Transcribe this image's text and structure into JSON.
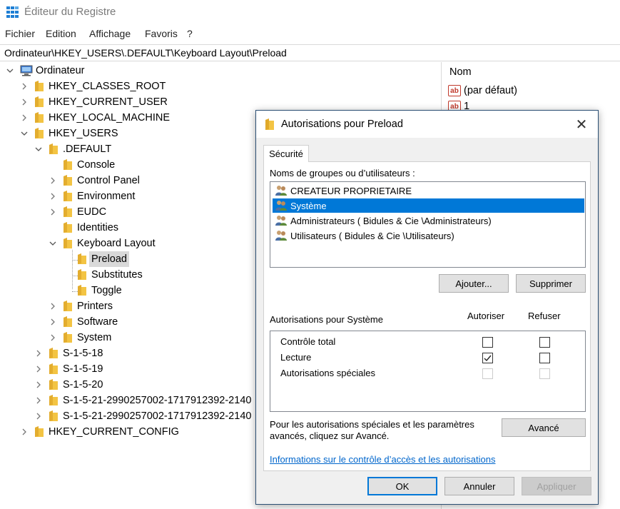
{
  "window": {
    "title": "Éditeur du Registre",
    "menu": [
      "Fichier",
      "Edition",
      "Affichage",
      "Favoris",
      "?"
    ],
    "address": "Ordinateur\\HKEY_USERS\\.DEFAULT\\Keyboard Layout\\Preload"
  },
  "tree": {
    "root": "Ordinateur",
    "hkcr": "HKEY_CLASSES_ROOT",
    "hkcu": "HKEY_CURRENT_USER",
    "hklm": "HKEY_LOCAL_MACHINE",
    "hku": "HKEY_USERS",
    "default": ".DEFAULT",
    "console": "Console",
    "control_panel": "Control Panel",
    "environment": "Environment",
    "eudc": "EUDC",
    "identities": "Identities",
    "keyboard_layout": "Keyboard Layout",
    "preload": "Preload",
    "substitutes": "Substitutes",
    "toggle": "Toggle",
    "printers": "Printers",
    "software": "Software",
    "system": "System",
    "s18": "S-1-5-18",
    "s19": "S-1-5-19",
    "s20": "S-1-5-20",
    "s21a": "S-1-5-21-2990257002-1717912392-2140",
    "s21b": "S-1-5-21-2990257002-1717912392-2140",
    "hkcc": "HKEY_CURRENT_CONFIG"
  },
  "values_pane": {
    "column_name": "Nom",
    "icon_text": "ab",
    "rows": [
      "(par défaut)",
      "1"
    ]
  },
  "dialog": {
    "title": "Autorisations pour Preload",
    "tab": "Sécurité",
    "groups_label": "Noms de groupes ou d’utilisateurs :",
    "users": [
      "CREATEUR PROPRIETAIRE",
      "Système",
      "Administrateurs ( Bidules & Cie \\Administrateurs)",
      "Utilisateurs ( Bidules & Cie \\Utilisateurs)"
    ],
    "selected_user_index": 1,
    "add_button": "Ajouter...",
    "remove_button": "Supprimer",
    "permissions_label": "Autorisations pour Système",
    "allow_header": "Autoriser",
    "deny_header": "Refuser",
    "permissions": [
      {
        "name": "Contrôle total",
        "allow": false,
        "deny": false,
        "enabled": true
      },
      {
        "name": "Lecture",
        "allow": true,
        "deny": false,
        "enabled": true
      },
      {
        "name": "Autorisations spéciales",
        "allow": false,
        "deny": false,
        "enabled": false
      }
    ],
    "advanced_text_line1": "Pour les autorisations spéciales et les paramètres",
    "advanced_text_line2": "avancés, cliquez sur Avancé.",
    "advanced_button": "Avancé",
    "info_link": "Informations sur le contrôle d’accès et les autorisations",
    "ok_button": "OK",
    "cancel_button": "Annuler",
    "apply_button": "Appliquer"
  },
  "colors": {
    "selection": "#0078d7",
    "folder": "#f3c443",
    "link": "#0066cc"
  }
}
